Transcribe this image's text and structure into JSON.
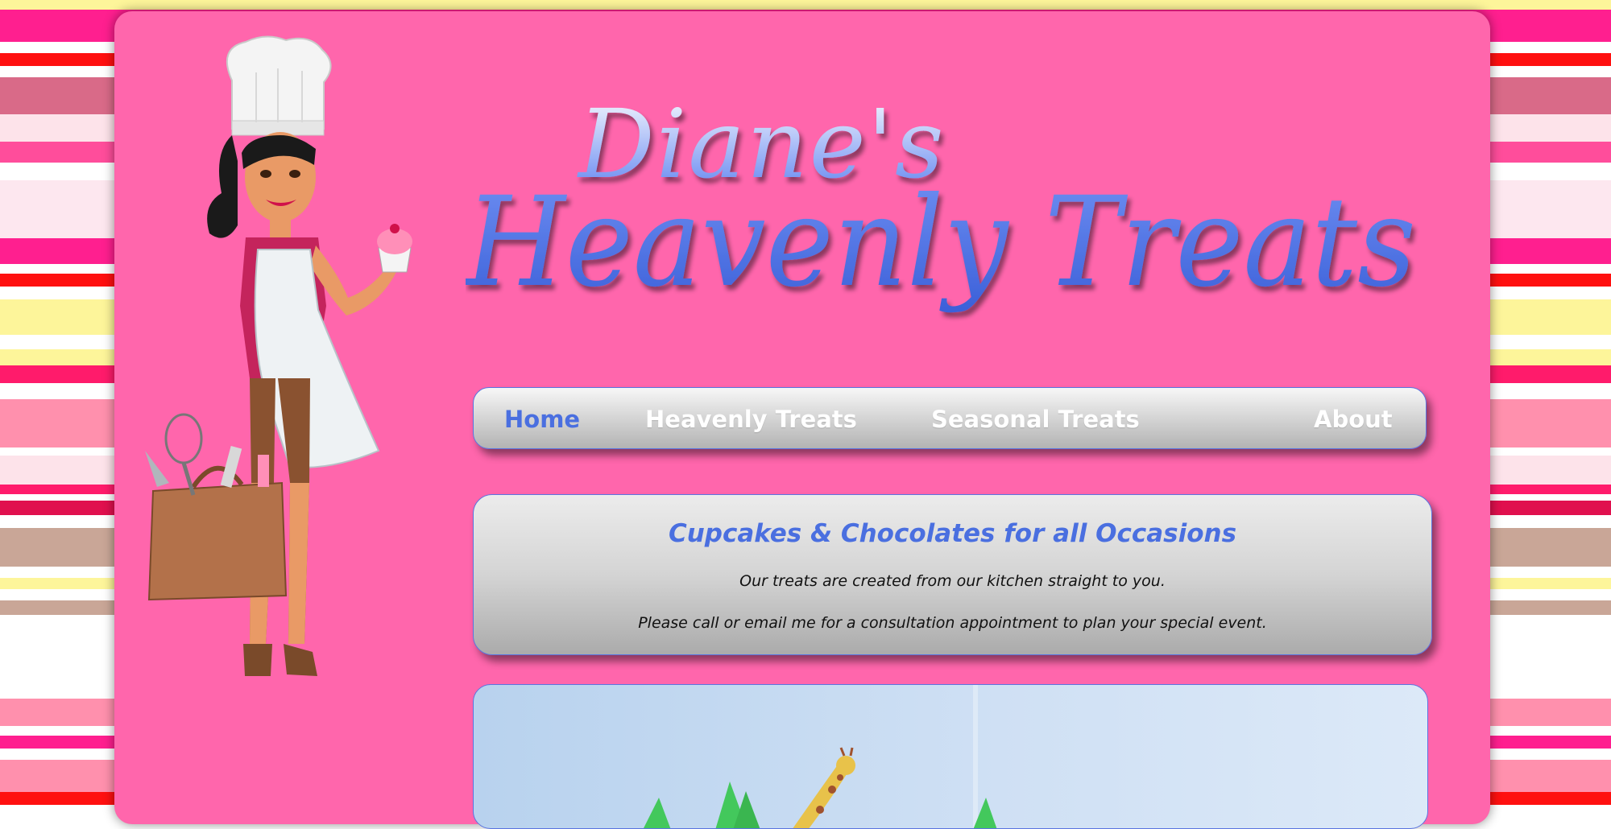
{
  "site": {
    "logo_line1": "Diane's",
    "logo_line2": "Heavenly Treats"
  },
  "nav": {
    "items": [
      {
        "label": "Home",
        "active": true
      },
      {
        "label": "Heavenly Treats",
        "active": false
      },
      {
        "label": "Seasonal Treats",
        "active": false
      },
      {
        "label": "About",
        "active": false
      }
    ]
  },
  "welcome": {
    "heading": "Cupcakes & Chocolates for all Occasions",
    "line1": "Our treats are created from our kitchen straight to you.",
    "line2": "Please call or email me for a consultation appointment to plan your special event."
  },
  "icons": {
    "chef": "chef-illustration-icon",
    "hero": "giraffe-cake-photo"
  },
  "colors": {
    "page_pink": "#ff66ac",
    "accent_blue": "#4a6fe0",
    "nav_text": "#ffffff"
  }
}
